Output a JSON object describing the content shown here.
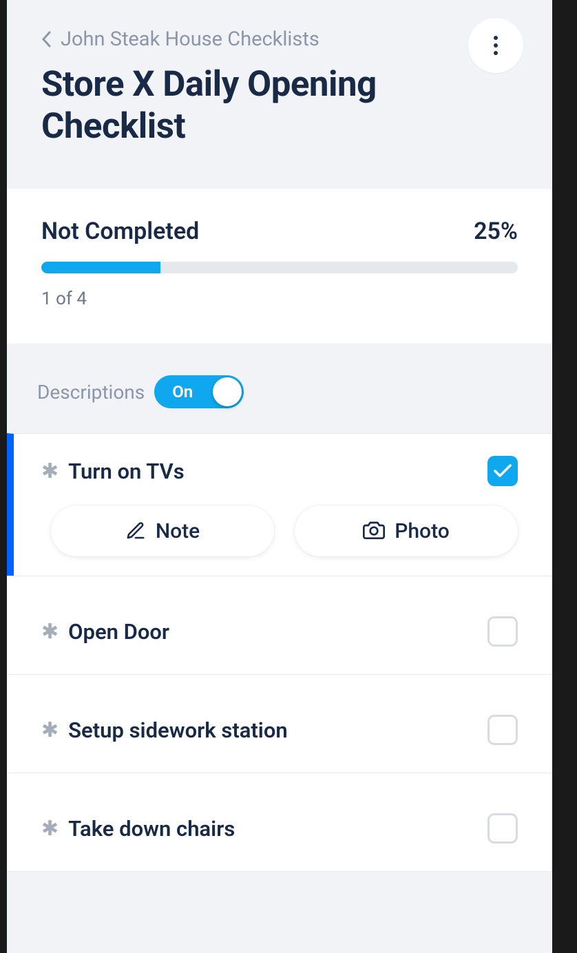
{
  "header": {
    "breadcrumb": "John Steak House Checklists",
    "title": "Store X Daily Opening Checklist"
  },
  "progress": {
    "status_label": "Not Completed",
    "percent": "25%",
    "count": "1 of 4",
    "fill_percent": 25
  },
  "descriptions": {
    "label": "Descriptions",
    "toggle_state": "On"
  },
  "tasks": [
    {
      "title": "Turn on TVs",
      "required": true,
      "completed": true,
      "active": true
    },
    {
      "title": "Open Door",
      "required": true,
      "completed": false,
      "active": false
    },
    {
      "title": "Setup sidework station",
      "required": true,
      "completed": false,
      "active": false
    },
    {
      "title": "Take down chairs",
      "required": true,
      "completed": false,
      "active": false
    }
  ],
  "actions": {
    "note_label": "Note",
    "photo_label": "Photo"
  }
}
